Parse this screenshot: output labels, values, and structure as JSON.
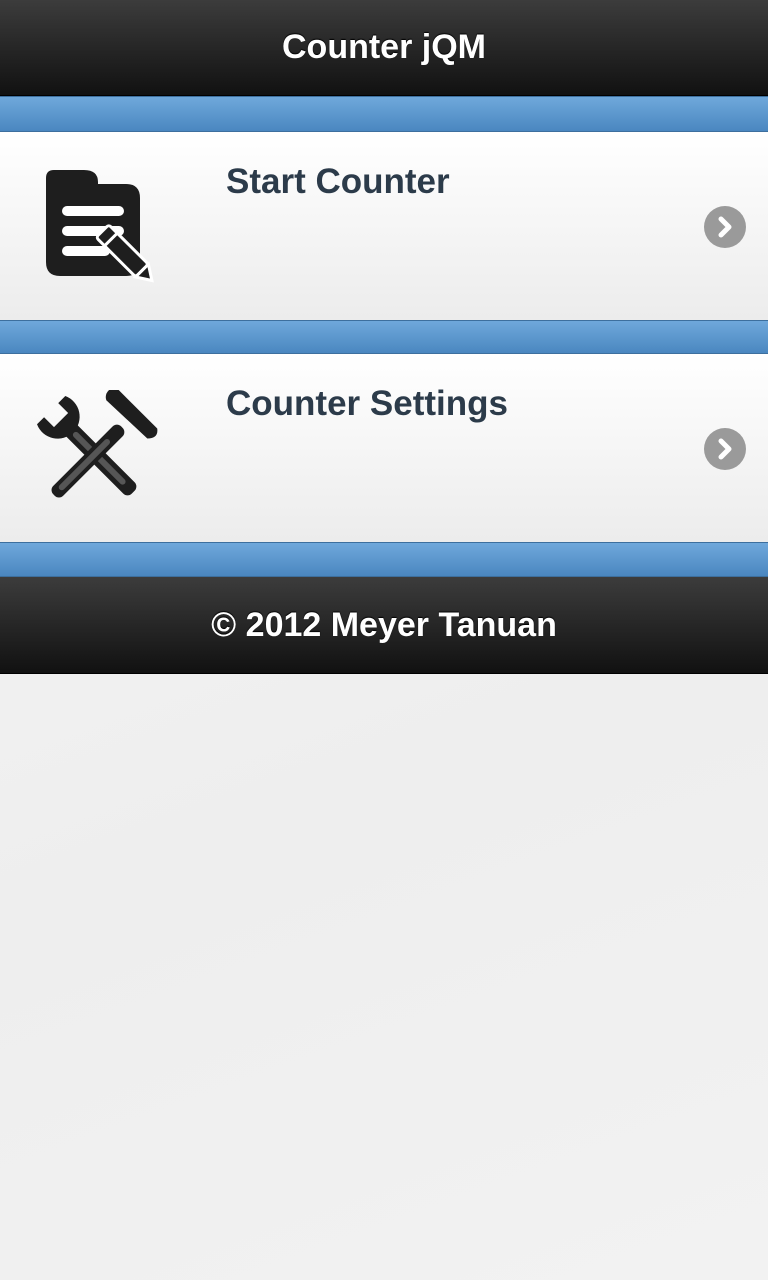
{
  "header": {
    "title": "Counter jQM"
  },
  "list": {
    "items": [
      {
        "label": "Start Counter",
        "icon": "document-edit-icon"
      },
      {
        "label": "Counter Settings",
        "icon": "tools-icon"
      }
    ]
  },
  "footer": {
    "text": "© 2012 Meyer Tanuan"
  },
  "colors": {
    "header_bg": "#1a1a1a",
    "divider_blue": "#5b97cf",
    "label_color": "#2c3b4a",
    "chevron_bg": "#9a9a9a"
  }
}
